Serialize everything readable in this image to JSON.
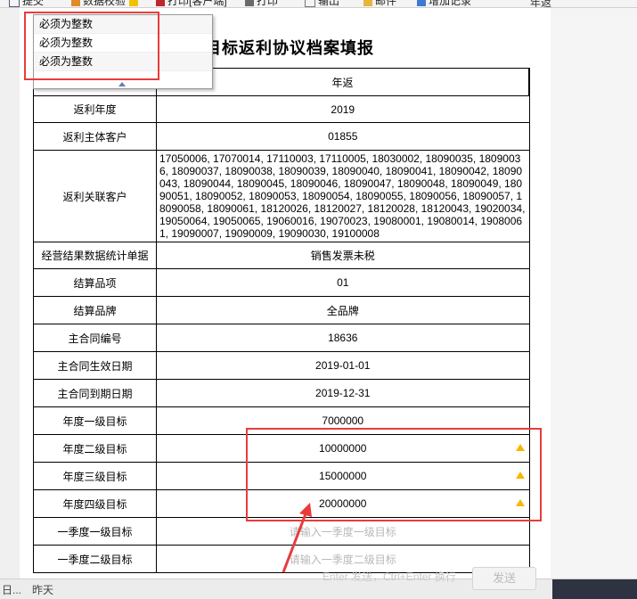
{
  "toolbar": {
    "items": [
      "提交",
      "数据校验",
      "打印[客户端]",
      "打印",
      "输出",
      "邮件",
      "增加记录"
    ],
    "right_text": "年返"
  },
  "dropdown": {
    "items": [
      "必须为整数",
      "必须为整数",
      "必须为整数"
    ]
  },
  "form": {
    "title": "目标返利协议档案填报",
    "header_value": "年返",
    "rows": [
      {
        "label": "返利年度",
        "value": "2019"
      },
      {
        "label": "返利主体客户",
        "value": "01855"
      },
      {
        "label": "返利关联客户",
        "value": "17050006, 17070014, 17110003, 17110005, 18030002, 18090035, 18090036, 18090037, 18090038, 18090039, 18090040, 18090041, 18090042, 18090043, 18090044, 18090045, 18090046, 18090047, 18090048, 18090049, 18090051, 18090052, 18090053, 18090054, 18090055, 18090056, 18090057, 18090058, 18090061, 18120026, 18120027, 18120028, 18120043, 19020034, 19050064, 19050065, 19060016, 19070023, 19080001, 19080014, 19080061, 19090007, 19090009, 19090030, 19100008"
      },
      {
        "label": "经营结果数据统计单据",
        "value": "销售发票未税"
      },
      {
        "label": "结算品项",
        "value": "01"
      },
      {
        "label": "结算品牌",
        "value": "全品牌"
      },
      {
        "label": "主合同编号",
        "value": "18636"
      },
      {
        "label": "主合同生效日期",
        "value": "2019-01-01"
      },
      {
        "label": "主合同到期日期",
        "value": "2019-12-31"
      },
      {
        "label": "年度一级目标",
        "value": "7000000"
      },
      {
        "label": "年度二级目标",
        "value": "10000000",
        "warning": true
      },
      {
        "label": "年度三级目标",
        "value": "15000000",
        "warning": true
      },
      {
        "label": "年度四级目标",
        "value": "20000000",
        "warning": true
      },
      {
        "label": "一季度一级目标",
        "placeholder": "请输入一季度一级目标"
      },
      {
        "label": "一季度二级目标",
        "placeholder": "请输入一季度二级目标"
      }
    ]
  },
  "statusbar": {
    "left1": "日...",
    "left2": "昨天",
    "hint": "Enter 发送，Ctrl+Enter 换行",
    "send": "发送"
  },
  "colors": {
    "annotation": "#e83c3c",
    "warning": "#f5b800"
  }
}
